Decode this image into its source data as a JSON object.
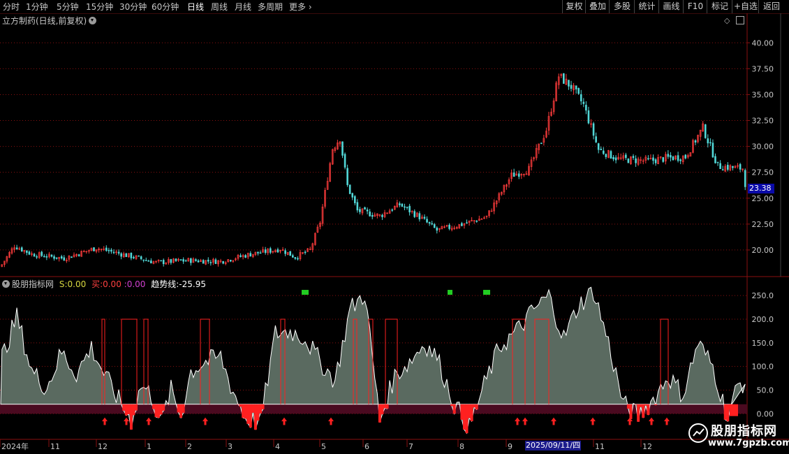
{
  "toolbar": {
    "timeframes": [
      "分时",
      "1分钟",
      "5分钟",
      "15分钟",
      "30分钟",
      "60分钟",
      "日线",
      "周线",
      "月线",
      "多周期",
      "更多"
    ],
    "active": "日线",
    "right_buttons": [
      "复权",
      "叠加",
      "多股",
      "统计",
      "画线",
      "F10",
      "标记",
      "+自选",
      "返回"
    ]
  },
  "stock": {
    "title": "立方制药(日线,前复权)"
  },
  "price_axis": {
    "labels": [
      "40.00",
      "37.50",
      "35.00",
      "32.50",
      "30.00",
      "27.50",
      "25.00",
      "22.50",
      "20.00"
    ],
    "current": "23.38"
  },
  "indicator": {
    "name": "股朋指标网",
    "s_label": "S:",
    "s_value": "0.00",
    "buy_label": "买:",
    "buy_value": "0.00",
    "sep": ":",
    "sep_value": "0.00",
    "trend_label": "趋势线:",
    "trend_value": "-25.95",
    "axis": [
      "250.0",
      "200.0",
      "150.0",
      "100.0",
      "50.0",
      "0.00"
    ]
  },
  "date_axis": {
    "labels": [
      "2024年",
      "11",
      "12",
      "1",
      "2",
      "3",
      "4",
      "5",
      "6",
      "7",
      "8",
      "9",
      "2025/09/11/四",
      "11",
      "12"
    ]
  },
  "watermark": {
    "line1": "股朋指标网",
    "line2": "www.7gpzb.com"
  },
  "colors": {
    "up": "#ff3c3c",
    "down": "#52d8d8",
    "fill": "#5a6a60",
    "band": "#4a0a20",
    "grid": "#8a1010",
    "signal": "#ff2020",
    "top": "#22cc22"
  }
}
